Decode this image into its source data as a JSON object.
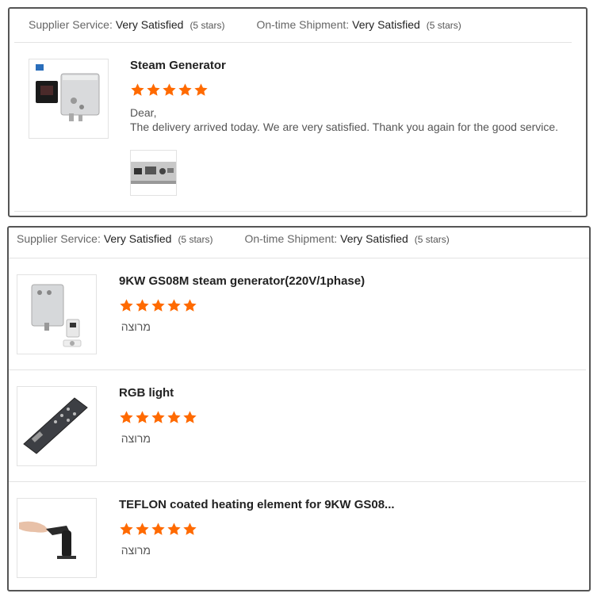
{
  "colors": {
    "star": "#ff6a00",
    "border": "#555555",
    "divider": "#e3e3e3"
  },
  "reviews": [
    {
      "supplier_label": "Supplier Service:",
      "supplier_value": "Very Satisfied",
      "supplier_count": "(5 stars)",
      "shipment_label": "On-time Shipment:",
      "shipment_value": "Very Satisfied",
      "shipment_count": "(5 stars)",
      "items": [
        {
          "title": "Steam Generator",
          "stars": 5,
          "comment_greeting": "Dear,",
          "comment_body": "The delivery arrived today. We are very satisfied. Thank you again for the good service.",
          "has_photo": true
        }
      ]
    },
    {
      "supplier_label": "Supplier Service:",
      "supplier_value": "Very Satisfied",
      "supplier_count": "(5 stars)",
      "shipment_label": "On-time Shipment:",
      "shipment_value": "Very Satisfied",
      "shipment_count": "(5 stars)",
      "items": [
        {
          "title": "9KW GS08M steam generator(220V/1phase)",
          "stars": 5,
          "comment": "מרוצה"
        },
        {
          "title": "RGB light",
          "stars": 5,
          "comment": "מרוצה"
        },
        {
          "title": "TEFLON coated heating element for 9KW GS08...",
          "stars": 5,
          "comment": "מרוצה"
        }
      ]
    }
  ]
}
